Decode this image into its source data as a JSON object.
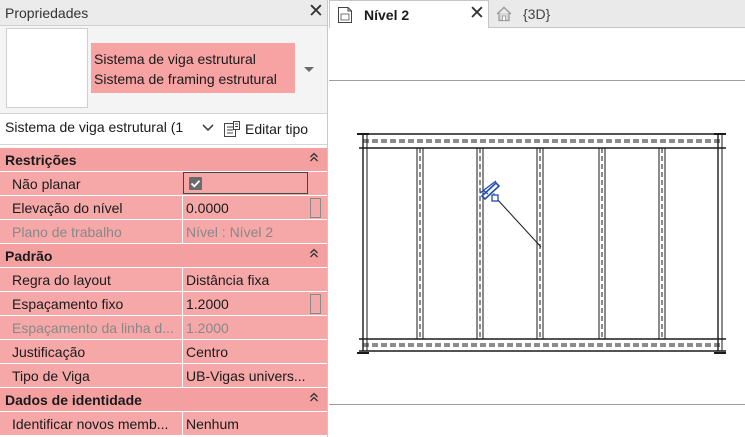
{
  "properties": {
    "title": "Propriedades",
    "close_icon": "close-icon",
    "type_selector": {
      "lines": [
        "Sistema de viga estrutural",
        "Sistema de framing estrutural"
      ],
      "highlight_color": "#f7a3a3"
    },
    "instance": {
      "selected": "Sistema de viga estrutural (1",
      "edit_type_label": "Editar tipo"
    },
    "groups": [
      {
        "name": "Restrições",
        "rows": [
          {
            "label": "Não planar",
            "value": "",
            "kind": "checkbox",
            "checked": true
          },
          {
            "label": "Elevação do nível",
            "value": "0.0000",
            "kind": "number"
          },
          {
            "label": "Plano de trabalho",
            "value": "Nível : Nível 2",
            "kind": "disabled"
          }
        ]
      },
      {
        "name": "Padrão",
        "rows": [
          {
            "label": "Regra do layout",
            "value": "Distância fixa",
            "kind": "text"
          },
          {
            "label": "Espaçamento fixo",
            "value": "1.2000",
            "kind": "number"
          },
          {
            "label": "Espaçamento da linha d...",
            "value": "1.2000",
            "kind": "disabled"
          },
          {
            "label": "Justificação",
            "value": "Centro",
            "kind": "text"
          },
          {
            "label": "Tipo de Viga",
            "value": "UB-Vigas univers...",
            "kind": "text"
          }
        ]
      },
      {
        "name": "Dados de identidade",
        "rows": [
          {
            "label": "Identificar novos memb...",
            "value": "Nenhum",
            "kind": "text"
          }
        ]
      }
    ],
    "grid_highlight_color": "#f6a8a8"
  },
  "tabs": [
    {
      "label": "Nível 2",
      "active": true,
      "icon": "floor-plan-icon"
    },
    {
      "label": "{3D}",
      "active": false,
      "icon": "3d-view-house-icon"
    }
  ],
  "drawing": {
    "joists": 7,
    "line_color": "#1a1a1a",
    "tag_color": "#1f4bb3"
  }
}
